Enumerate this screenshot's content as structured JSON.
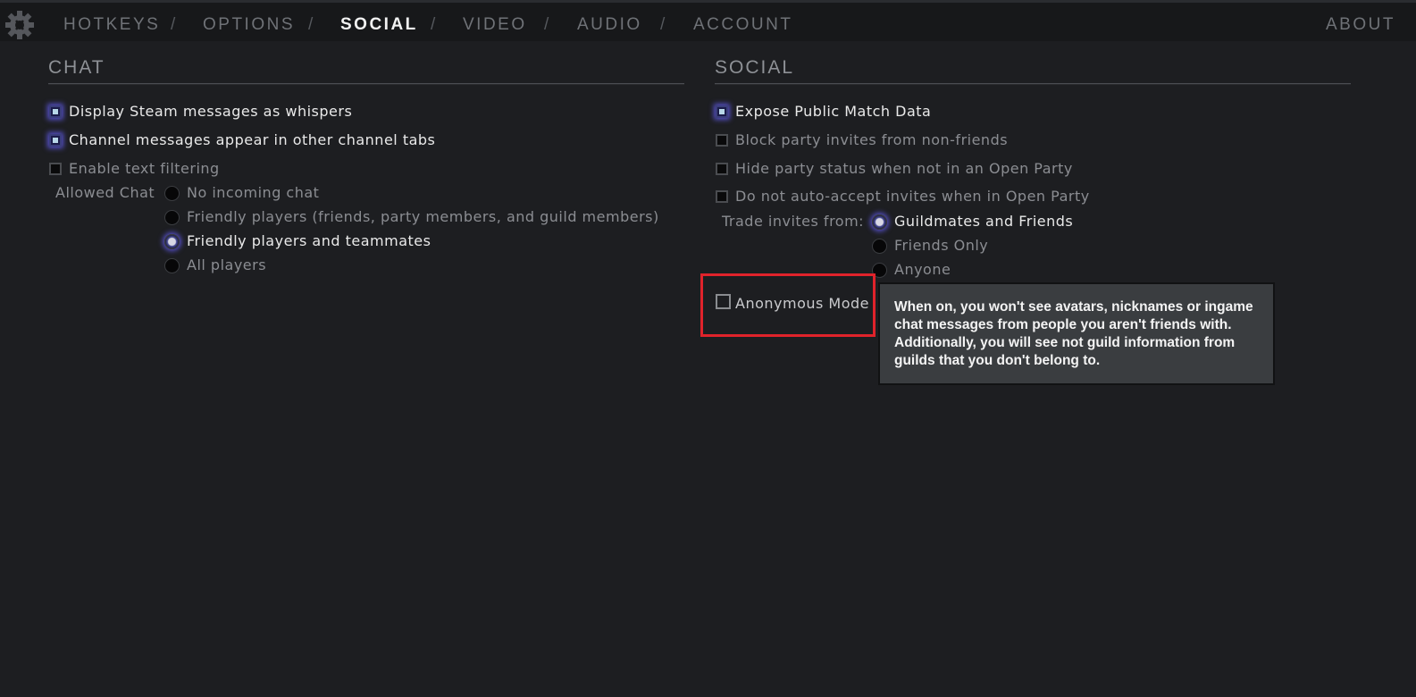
{
  "nav": {
    "tabs": [
      {
        "label": "HOTKEYS"
      },
      {
        "label": "OPTIONS"
      },
      {
        "label": "SOCIAL"
      },
      {
        "label": "VIDEO"
      },
      {
        "label": "AUDIO"
      },
      {
        "label": "ACCOUNT"
      }
    ],
    "active_tab": "SOCIAL",
    "separator": "/",
    "about": "ABOUT"
  },
  "chat": {
    "title": "CHAT",
    "display_steam": {
      "label": "Display Steam messages as whispers",
      "checked": true
    },
    "channel_messages": {
      "label": "Channel messages appear in other channel tabs",
      "checked": true
    },
    "text_filtering": {
      "label": "Enable text filtering",
      "checked": false
    },
    "allowed_chat": {
      "label": "Allowed Chat",
      "options": [
        {
          "label": "No incoming chat",
          "selected": false
        },
        {
          "label": "Friendly players (friends, party members, and guild members)",
          "selected": false
        },
        {
          "label": "Friendly players and teammates",
          "selected": true
        },
        {
          "label": "All players",
          "selected": false
        }
      ]
    }
  },
  "social": {
    "title": "SOCIAL",
    "expose_match": {
      "label": "Expose Public Match Data",
      "checked": true
    },
    "block_party": {
      "label": "Block party invites from non-friends",
      "checked": false
    },
    "hide_party": {
      "label": "Hide party status when not in an Open Party",
      "checked": false
    },
    "no_auto_accept": {
      "label": "Do not auto-accept invites when in Open Party",
      "checked": false
    },
    "trade_invites": {
      "label": "Trade invites from:",
      "options": [
        {
          "label": "Guildmates and Friends",
          "selected": true
        },
        {
          "label": "Friends Only",
          "selected": false
        },
        {
          "label": "Anyone",
          "selected": false
        }
      ]
    },
    "anonymous_mode": {
      "label": "Anonymous Mode",
      "checked": false
    }
  },
  "tooltip": {
    "lines": [
      "When on, you won't see avatars, nicknames or ingame",
      "chat messages from people you aren't friends with.",
      "Additionally, you will see not guild information from",
      "guilds that you don't belong to."
    ]
  },
  "colors": {
    "background": "#1d1e21",
    "accent_glow": "#5650c8",
    "highlight": "#e0232b",
    "tooltip_bg": "#3a3d40"
  }
}
